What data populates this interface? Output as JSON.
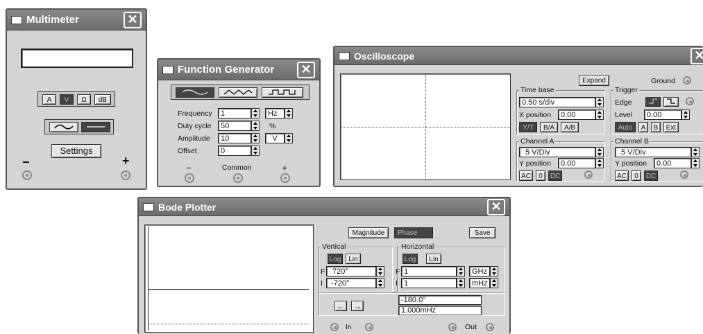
{
  "multimeter": {
    "title": "Multimeter",
    "close": "✕",
    "display_value": "",
    "mode_labels": [
      "A",
      "V",
      "Ω",
      "dB"
    ],
    "settings_label": "Settings",
    "minus_label": "−",
    "plus_label": "+"
  },
  "function_generator": {
    "title": "Function Generator",
    "close": "✕",
    "frequency_label": "Frequency",
    "frequency_value": "1",
    "frequency_unit": "Hz",
    "duty_label": "Duty cycle",
    "duty_value": "50",
    "duty_unit": "%",
    "amplitude_label": "Amplitude",
    "amplitude_value": "10",
    "amplitude_unit": "V",
    "offset_label": "Offset",
    "offset_value": "0",
    "minus_label": "−",
    "common_label": "Common",
    "plus_label": "+"
  },
  "oscilloscope": {
    "title": "Oscilloscope",
    "close": "✕",
    "expand_label": "Expand",
    "ground_label": "Ground",
    "timebase_title": "Time base",
    "timebase_value": "0.50 s/div",
    "xpos_label": "X position",
    "xpos_value": "0.00",
    "yt_label": "Y/T",
    "ba_label": "B/A",
    "ab_label": "A/B",
    "trigger_title": "Trigger",
    "edge_label": "Edge",
    "level_label": "Level",
    "level_value": "0.00",
    "auto_label": "Auto",
    "trig_a_label": "A",
    "trig_b_label": "B",
    "ext_label": "Ext",
    "channel_a_title": "Channel A",
    "channel_a_value": "5 V/Div",
    "channel_a_ypos_label": "Y position",
    "channel_a_ypos_value": "0.00",
    "channel_b_title": "Channel B",
    "channel_b_value": "5 V/Div",
    "channel_b_ypos_label": "Y position",
    "channel_b_ypos_value": "0.00",
    "ac_label": "AC",
    "zero_label": "0",
    "dc_label": "DC"
  },
  "bode_plotter": {
    "title": "Bode Plotter",
    "close": "✕",
    "magnitude_label": "Magnitude",
    "phase_label": "Phase",
    "save_label": "Save",
    "vertical_title": "Vertical",
    "horizontal_title": "Horizontal",
    "log_label": "Log",
    "lin_label": "Lin",
    "f_label": "F",
    "i_label": "I",
    "vertical_f_value": "720°",
    "vertical_i_value": "-720°",
    "horizontal_f_value": "1",
    "horizontal_f_unit": "GHz",
    "horizontal_i_value": "1",
    "horizontal_i_unit": "mHz",
    "left_arrow": "←",
    "right_arrow": "→",
    "readout_phase": "-180.0°",
    "readout_freq": "1.000mHz",
    "in_label": "In",
    "out_label": "Out"
  }
}
